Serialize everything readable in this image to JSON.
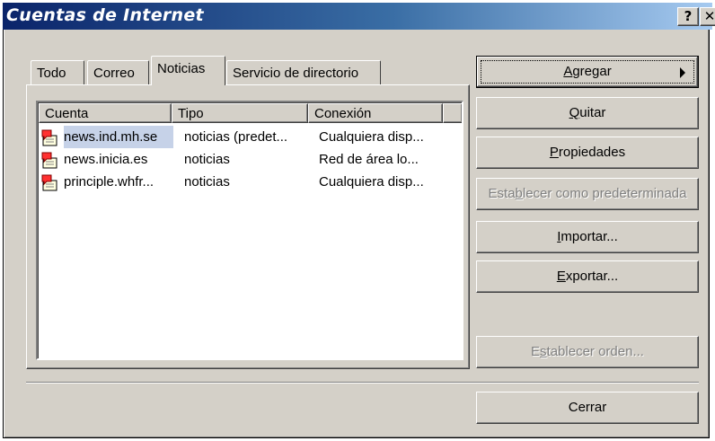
{
  "window": {
    "title": "Cuentas de Internet",
    "help_button": "?",
    "close_button": "✕"
  },
  "tabs": [
    {
      "label": "Todo"
    },
    {
      "label": "Correo"
    },
    {
      "label": "Noticias",
      "active": true
    },
    {
      "label": "Servicio de directorio"
    }
  ],
  "list": {
    "columns": [
      "Cuenta",
      "Tipo",
      "Conexión"
    ],
    "rows": [
      {
        "icon": "news-account-icon",
        "cuenta": "news.ind.mh.se",
        "tipo": "noticias (predet...",
        "conexion": "Cualquiera disp..."
      },
      {
        "icon": "news-account-icon",
        "cuenta": "news.inicia.es",
        "tipo": "noticias",
        "conexion": "Red de área lo..."
      },
      {
        "icon": "news-account-icon",
        "cuenta": "principle.whfr...",
        "tipo": "noticias",
        "conexion": "Cualquiera disp..."
      }
    ]
  },
  "buttons": {
    "agregar": {
      "pre": "",
      "key": "A",
      "post": "gregar",
      "enabled": true
    },
    "quitar": {
      "pre": "",
      "key": "Q",
      "post": "uitar",
      "enabled": true
    },
    "propiedades": {
      "pre": "",
      "key": "P",
      "post": "ropiedades",
      "enabled": true
    },
    "establecer_predeterminada": {
      "pre": "Esta",
      "key": "b",
      "post": "lecer como predeterminada",
      "enabled": false
    },
    "importar": {
      "pre": "",
      "key": "I",
      "post": "mportar...",
      "enabled": true
    },
    "exportar": {
      "pre": "",
      "key": "E",
      "post": "xportar...",
      "enabled": true
    },
    "establecer_orden": {
      "pre": "E",
      "key": "s",
      "post": "tablecer orden...",
      "enabled": false
    },
    "cerrar": {
      "label": "Cerrar",
      "enabled": true
    }
  },
  "colors": {
    "title_start": "#0a246a",
    "title_end": "#a6caf0",
    "face": "#d4d0c8",
    "disabled_text": "#808080"
  }
}
